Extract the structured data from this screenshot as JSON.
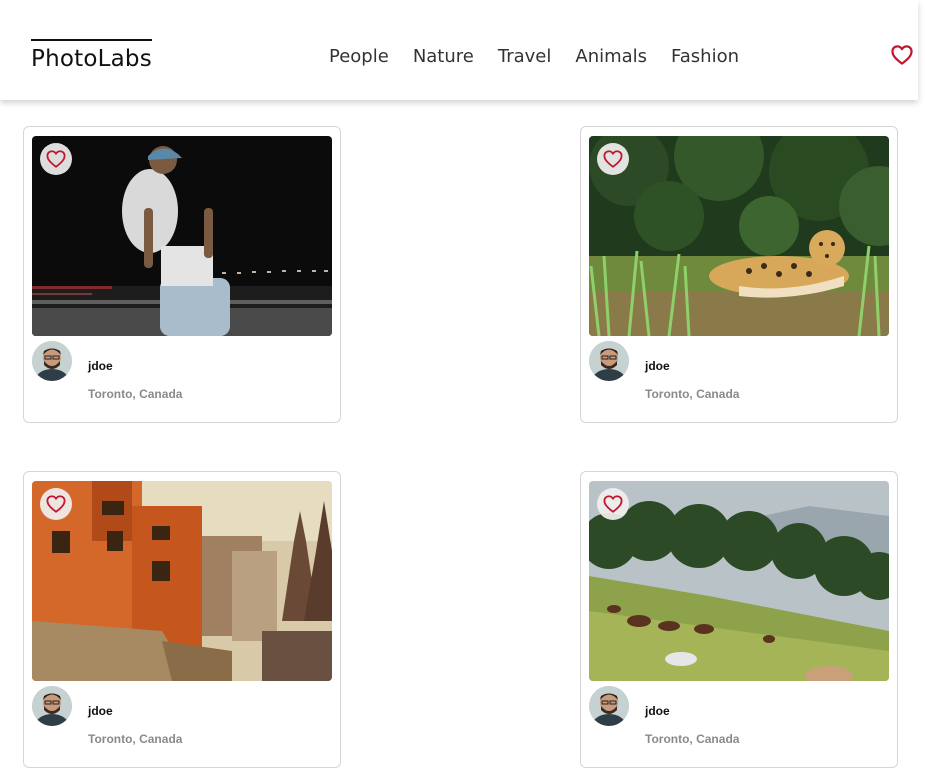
{
  "app": {
    "title": "PhotoLabs"
  },
  "nav": {
    "topics": [
      {
        "label": "People"
      },
      {
        "label": "Nature"
      },
      {
        "label": "Travel"
      },
      {
        "label": "Animals"
      },
      {
        "label": "Fashion"
      }
    ]
  },
  "colors": {
    "heart": "#c0172f",
    "accent": "#111111",
    "muted": "#8a8a8a"
  },
  "icons": {
    "favourites": "heart-icon",
    "favourite_photo": "heart-icon"
  },
  "photos": [
    {
      "subject": "man-walking-night-street",
      "user": {
        "username": "jdoe",
        "location": "Toronto, Canada"
      }
    },
    {
      "subject": "jaguar-in-grass",
      "user": {
        "username": "jdoe",
        "location": "Toronto, Canada"
      }
    },
    {
      "subject": "orange-buildings-temple",
      "user": {
        "username": "jdoe",
        "location": "Toronto, Canada"
      }
    },
    {
      "subject": "horses-on-hill",
      "user": {
        "username": "jdoe",
        "location": "Toronto, Canada"
      }
    }
  ]
}
